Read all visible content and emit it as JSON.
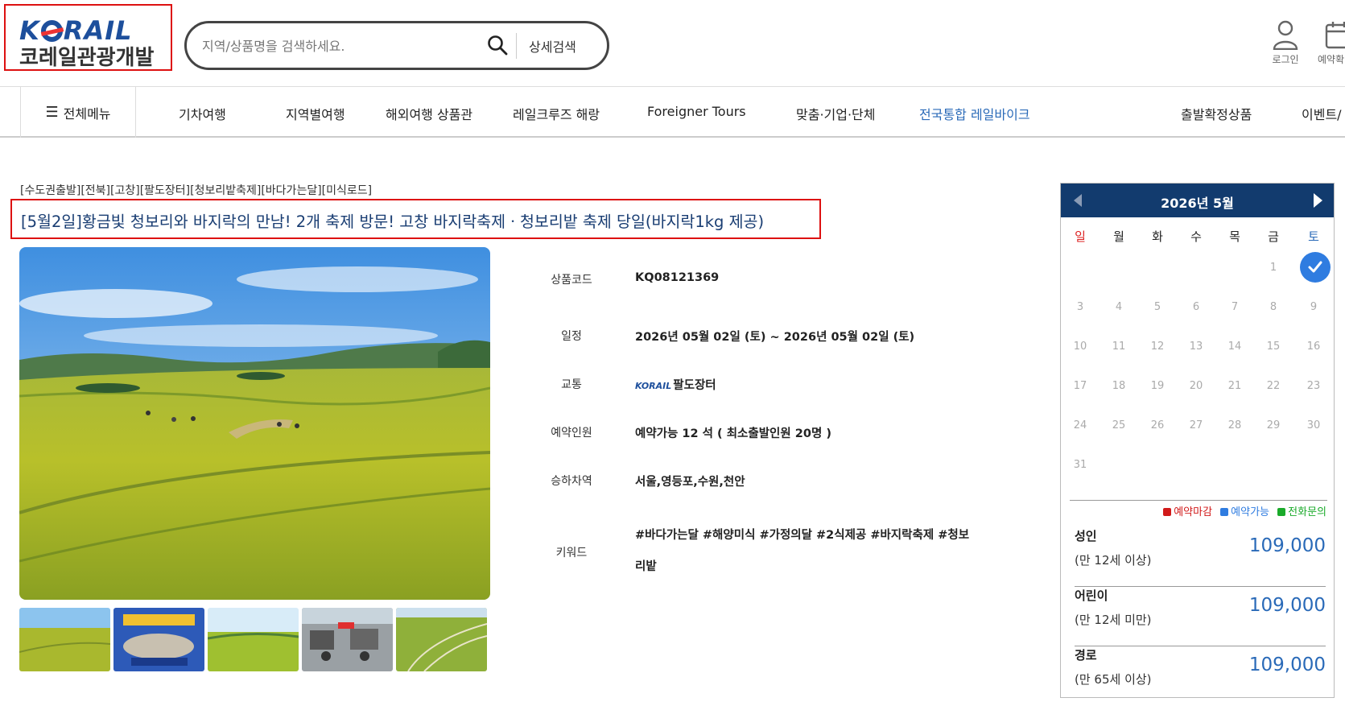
{
  "brand": {
    "logo_en": "KORAIL",
    "logo_ko": "코레일관광개발"
  },
  "search": {
    "placeholder": "지역/상품명을 검색하세요.",
    "detail_label": "상세검색"
  },
  "utility": {
    "login_label": "로그인",
    "reservation_label": "예약확"
  },
  "nav": {
    "all_menu": "전체메뉴",
    "items": [
      "기차여행",
      "지역별여행",
      "해외여행 상품관",
      "레일크루즈 해랑",
      "Foreigner Tours",
      "맞춤·기업·단체",
      "전국통합 레일바이크",
      "출발확정상품",
      "이벤트/"
    ]
  },
  "product": {
    "breadcrumb": "[수도권출발][전북][고창][팔도장터][청보리밭축제][바다가는달][미식로드]",
    "title": "[5월2일]황금빛 청보리와 바지락의 만남! 2개 축제 방문! 고창 바지락축제ㆍ청보리밭 축제 당일(바지락1kg 제공)",
    "fields": [
      {
        "label": "상품코드",
        "value": "KQ08121369"
      },
      {
        "label": "일정",
        "value": "2026년 05월 02일 (토) ~ 2026년 05월 02일 (토)"
      },
      {
        "label": "교통",
        "value": "팔도장터",
        "badge": "KORAIL"
      },
      {
        "label": "예약인원",
        "value": "예약가능 12 석 ( 최소출발인원  20명 )"
      },
      {
        "label": "승하차역",
        "value": "서울,영등포,수원,천안"
      },
      {
        "label": "키워드",
        "value": "#바다가는달 #해양미식 #가정의달 #2식제공 #바지락축제 #청보리밭"
      }
    ]
  },
  "calendar": {
    "month_label": "2026년 5월",
    "weekdays": [
      "일",
      "월",
      "화",
      "수",
      "목",
      "금",
      "토"
    ],
    "days": [
      "1",
      "2",
      "3",
      "4",
      "5",
      "6",
      "7",
      "8",
      "9",
      "10",
      "11",
      "12",
      "13",
      "14",
      "15",
      "16",
      "17",
      "18",
      "19",
      "20",
      "21",
      "22",
      "23",
      "24",
      "25",
      "26",
      "27",
      "28",
      "29",
      "30",
      "31"
    ],
    "selected_day": "2",
    "legend": [
      {
        "label": "예약마감",
        "color": "#d11a1a"
      },
      {
        "label": "예약가능",
        "color": "#2f7ce0"
      },
      {
        "label": "전화문의",
        "color": "#1aaa2a"
      }
    ]
  },
  "prices": [
    {
      "type": "성인",
      "condition": "(만 12세 이상)",
      "amount": "109,000"
    },
    {
      "type": "어린이",
      "condition": "(만 12세 미만)",
      "amount": "109,000"
    },
    {
      "type": "경로",
      "condition": "(만 65세 이상)",
      "amount": "109,000"
    }
  ],
  "colors": {
    "brand_blue": "#1d4f9c",
    "nav_highlight": "#2a6ab8",
    "calendar_header": "#123b6e",
    "price": "#2a6ab8",
    "highlight_border": "#dd1111"
  }
}
